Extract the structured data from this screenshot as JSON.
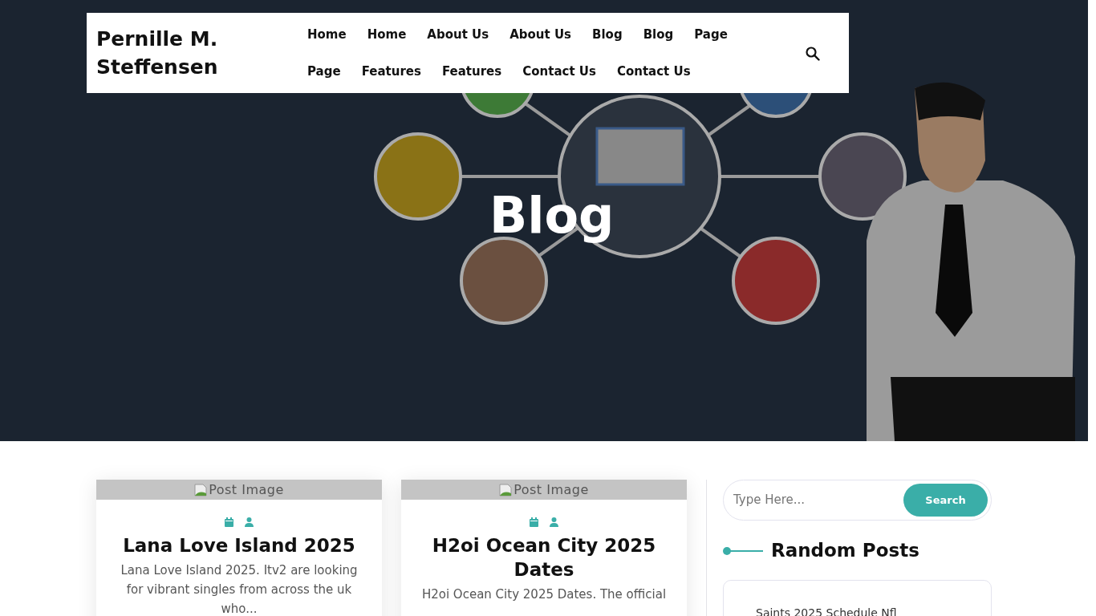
{
  "site_title": "Pernille M. Steffensen",
  "nav": [
    {
      "label": "Home"
    },
    {
      "label": "Home"
    },
    {
      "label": "About Us"
    },
    {
      "label": "About Us"
    },
    {
      "label": "Blog"
    },
    {
      "label": "Blog"
    },
    {
      "label": "Page"
    },
    {
      "label": "Page"
    },
    {
      "label": "Features"
    },
    {
      "label": "Features"
    },
    {
      "label": "Contact Us"
    },
    {
      "label": "Contact Us"
    }
  ],
  "hero": {
    "kind": "picture",
    "title": "Blog"
  },
  "posts": [
    {
      "image_alt": "Post Image",
      "title": "Lana Love Island 2025",
      "excerpt": "Lana Love Island 2025. Itv2 are looking for vibrant singles from across the uk who..."
    },
    {
      "image_alt": "Post Image",
      "title": "H2oi Ocean City 2025 Dates",
      "excerpt": "H2oi Ocean City 2025 Dates. The official"
    }
  ],
  "sidebar": {
    "search": {
      "placeholder": "Type Here...",
      "button": "Search"
    },
    "heading": "Random Posts",
    "random_posts": [
      "Saints 2025 Schedule Nfl"
    ]
  }
}
